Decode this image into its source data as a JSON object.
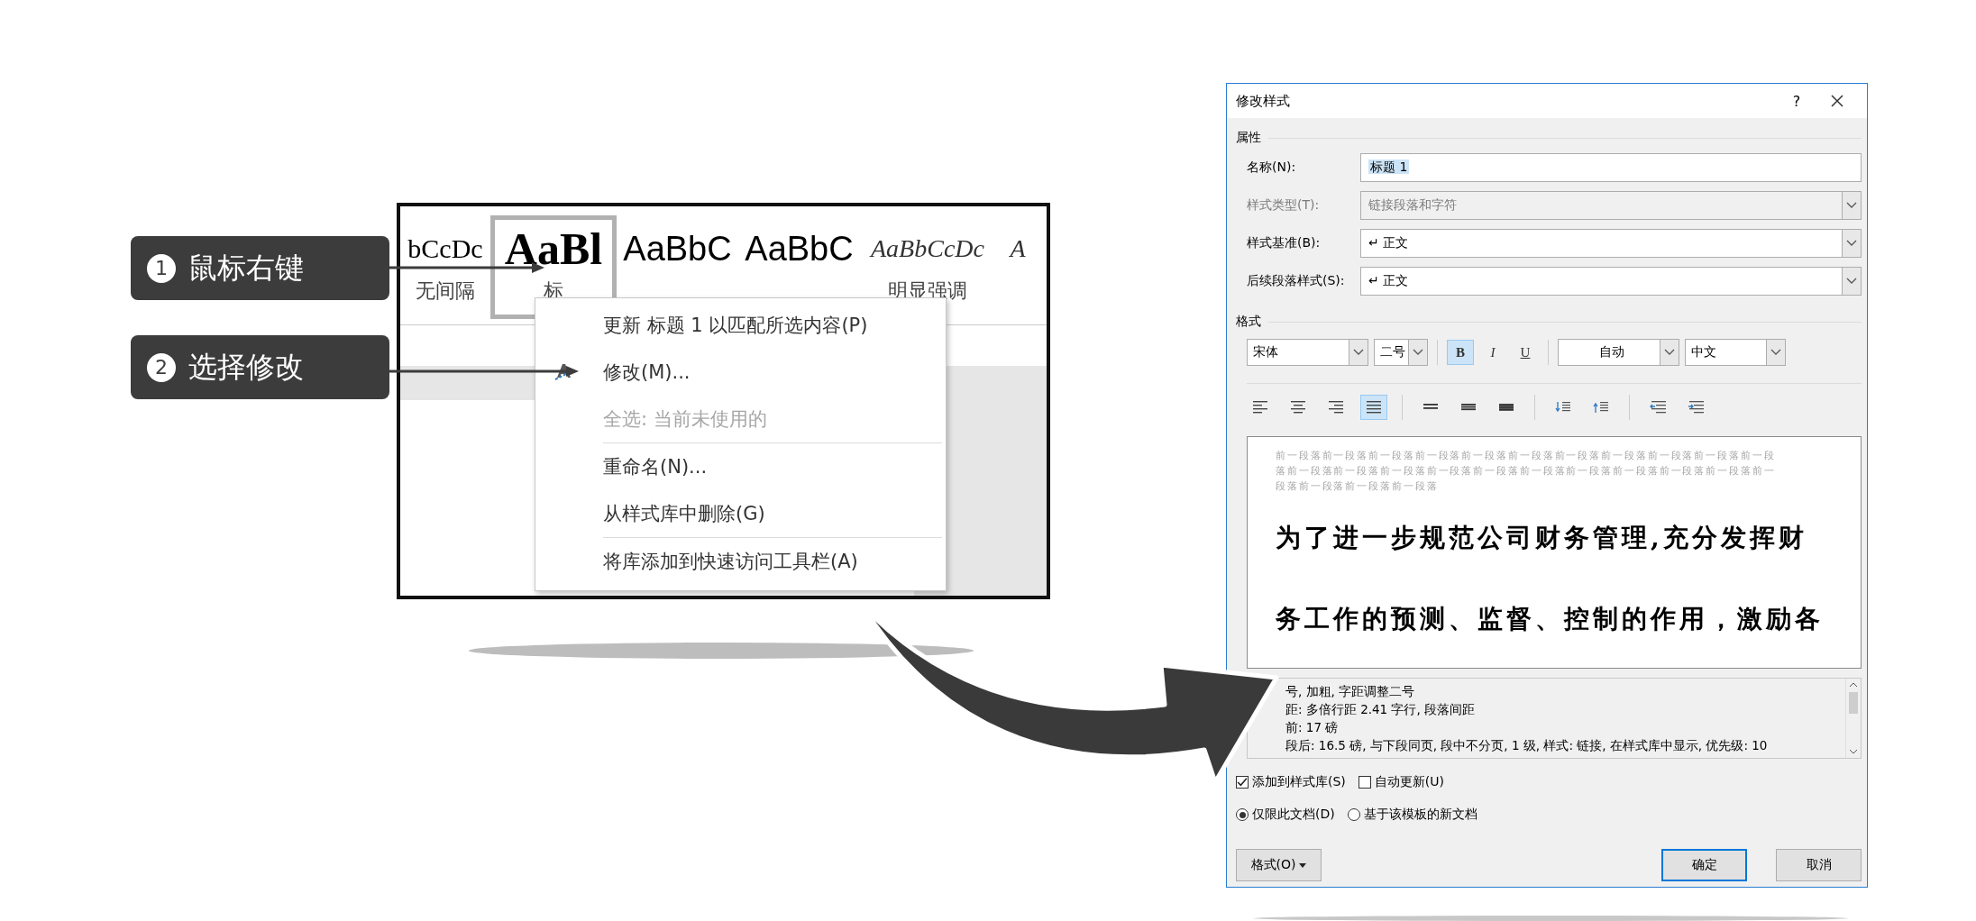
{
  "callouts": [
    {
      "number": "1",
      "text": "鼠标右键"
    },
    {
      "number": "2",
      "text": "选择修改"
    }
  ],
  "style_gallery": {
    "items": [
      {
        "preview": "bCcDc",
        "label": "无间隔",
        "kind": "normal",
        "selected": false
      },
      {
        "preview": "AaBl",
        "label": "标",
        "kind": "heading",
        "selected": true
      },
      {
        "preview": "AaBbC",
        "kind": "title",
        "selected": false
      },
      {
        "preview": "AaBbC",
        "kind": "title",
        "selected": false
      },
      {
        "preview": "AaBbCcDc",
        "label": "明显强调",
        "kind": "emphasis",
        "selected": false
      },
      {
        "preview": "A",
        "kind": "emphasis",
        "selected": false
      }
    ]
  },
  "context_menu": {
    "items": [
      {
        "text": "更新 标题 1 以匹配所选内容(P)",
        "disabled": false,
        "separator_before": false
      },
      {
        "text": "修改(M)...",
        "disabled": false,
        "separator_before": false,
        "kind": "icon"
      },
      {
        "text": "全选: 当前未使用的",
        "disabled": true,
        "separator_before": false
      },
      {
        "text": "重命名(N)...",
        "disabled": false,
        "separator_before": true
      },
      {
        "text": "从样式库中删除(G)",
        "disabled": false,
        "separator_before": false
      },
      {
        "text": "将库添加到快速访问工具栏(A)",
        "disabled": false,
        "separator_before": true
      }
    ]
  },
  "dialog": {
    "title": "修改样式",
    "help": "?",
    "properties": {
      "heading": "属性",
      "fields": [
        {
          "label": "名称(N):",
          "value": "标题 1",
          "kind": "text",
          "disabled": false
        },
        {
          "label": "样式类型(T):",
          "value": "链接段落和字符",
          "kind": "select",
          "disabled": true
        },
        {
          "label": "样式基准(B):",
          "value": "↵ 正文",
          "kind": "select",
          "disabled": false
        },
        {
          "label": "后续段落样式(S):",
          "value": "↵ 正文",
          "kind": "select",
          "disabled": false
        }
      ]
    },
    "format": {
      "heading": "格式",
      "font": "宋体",
      "size": "二号",
      "styles": [
        {
          "text": "B",
          "kind": "bold",
          "selected": true
        },
        {
          "text": "I",
          "kind": "italic",
          "selected": false
        },
        {
          "text": "U",
          "kind": "underline",
          "selected": false
        }
      ],
      "color_setting": "自动",
      "script": "中文",
      "alignments": [
        {
          "kind": "left",
          "selected": false
        },
        {
          "kind": "center",
          "selected": false
        },
        {
          "kind": "right",
          "selected": false
        },
        {
          "kind": "justify",
          "selected": true
        }
      ]
    },
    "preview": {
      "previous_paragraph": "前一段落前一段落前一段落前一段落前一段落前一段落前一段落前一段落前一段落前一段落前一段落前一段落前一段落前一段落前一段落前一段落前一段落前一段落前一段落前一段落前一段落前一段落前一段落前一段落前一段落",
      "sample_lines": [
        "为了进一步规范公司财务管理,充分发挥财",
        "务工作的预测、监督、控制的作用，激励各"
      ]
    },
    "description": [
      "号, 加粗, 字距调整二号",
      "距: 多倍行距 2.41 字行, 段落间距",
      "前: 17 磅",
      "段后: 16.5 磅, 与下段同页, 段中不分页, 1 级, 样式: 链接, 在样式库中显示, 优先级: 10"
    ],
    "checkboxes": [
      {
        "label": "添加到样式库(S)",
        "checked": true
      },
      {
        "label": "自动更新(U)",
        "checked": false
      }
    ],
    "radios": [
      {
        "label": "仅限此文档(D)",
        "selected": true
      },
      {
        "label": "基于该模板的新文档",
        "selected": false
      }
    ],
    "format_button": "格式(O)",
    "buttons": [
      {
        "label": "确定",
        "default": true
      },
      {
        "label": "取消",
        "default": false
      }
    ]
  }
}
